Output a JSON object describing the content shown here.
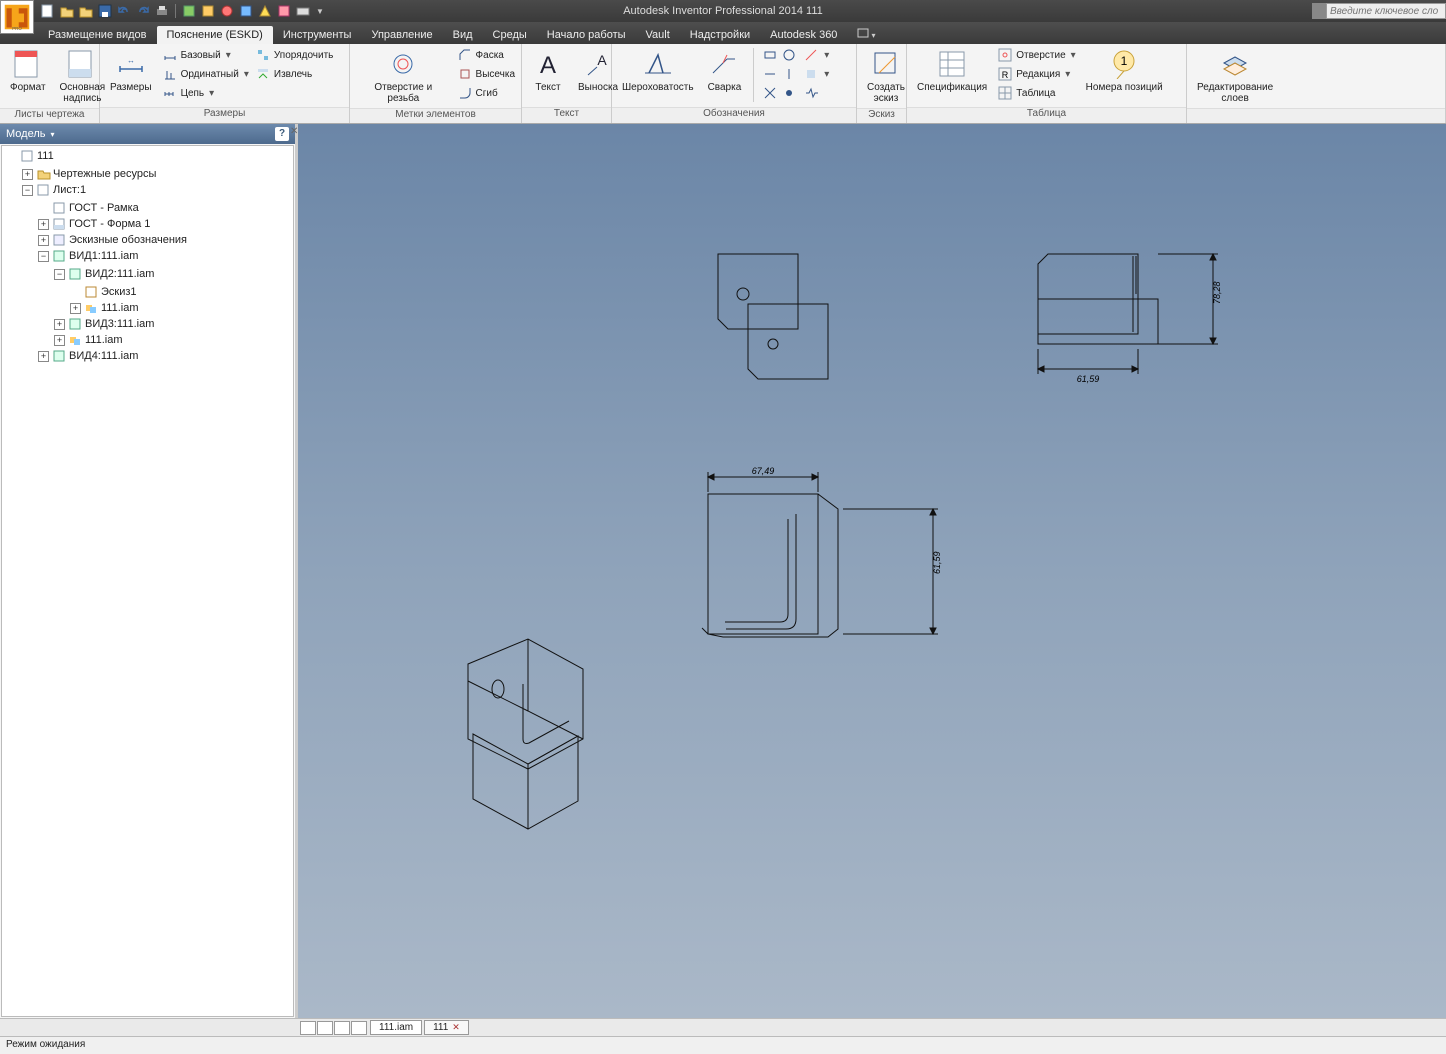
{
  "app": {
    "title": "Autodesk Inventor Professional 2014   111",
    "search_placeholder": "Введите ключевое сло"
  },
  "tabs": {
    "items": [
      "Размещение видов",
      "Пояснение (ESKD)",
      "Инструменты",
      "Управление",
      "Вид",
      "Среды",
      "Начало работы",
      "Vault",
      "Надстройки",
      "Autodesk 360"
    ],
    "active_index": 1
  },
  "ribbon": {
    "p0": {
      "label": "Листы чертежа",
      "btn0": "Формат",
      "btn1": "Основная\nнадпись"
    },
    "p1": {
      "label": "Размеры",
      "btn0": "Размеры",
      "r0": "Базовый",
      "r1": "Ординатный",
      "r2": "Цепь",
      "r3": "Упорядочить",
      "r4": "Извлечь"
    },
    "p2": {
      "label": "Метки элементов",
      "btn0": "Отверстие и резьба",
      "r0": "Фаска",
      "r1": "Высечка",
      "r2": "Сгиб"
    },
    "p3": {
      "label": "Текст",
      "btn0": "Текст",
      "btn1": "Выноска"
    },
    "p4": {
      "label": "Обозначения",
      "btn0": "Шероховатость",
      "btn1": "Сварка"
    },
    "p5": {
      "label": "Эскиз",
      "btn0": "Создать\nэскиз"
    },
    "p6": {
      "label": "Таблица",
      "btn0": "Спецификация",
      "btn1": "Номера позиций",
      "r0": "Отверстие",
      "r1": "Редакция",
      "r2": "Таблица"
    },
    "p7": {
      "label": "",
      "btn0": "Редактирование\nслоев"
    }
  },
  "model": {
    "header": "Модель",
    "root": "111",
    "n0": "Чертежные ресурсы",
    "n1": "Лист:1",
    "n1_0": "ГОСТ - Рамка",
    "n1_1": "ГОСТ - Форма 1",
    "n1_2": "Эскизные обозначения",
    "n1_3": "ВИД1:111.iam",
    "n1_3_0": "ВИД2:111.iam",
    "n1_3_0_0": "Эскиз1",
    "n1_3_0_1": "111.iam",
    "n1_3_1": "ВИД3:111.iam",
    "n1_3_2": "111.iam",
    "n1_4": "ВИД4:111.iam"
  },
  "dims": {
    "d1": "78,28",
    "d2": "61,59",
    "d3": "67,49",
    "d4": "61,59"
  },
  "doctabs": {
    "t0": "111.iam",
    "t1": "111"
  },
  "status": "Режим ожидания"
}
